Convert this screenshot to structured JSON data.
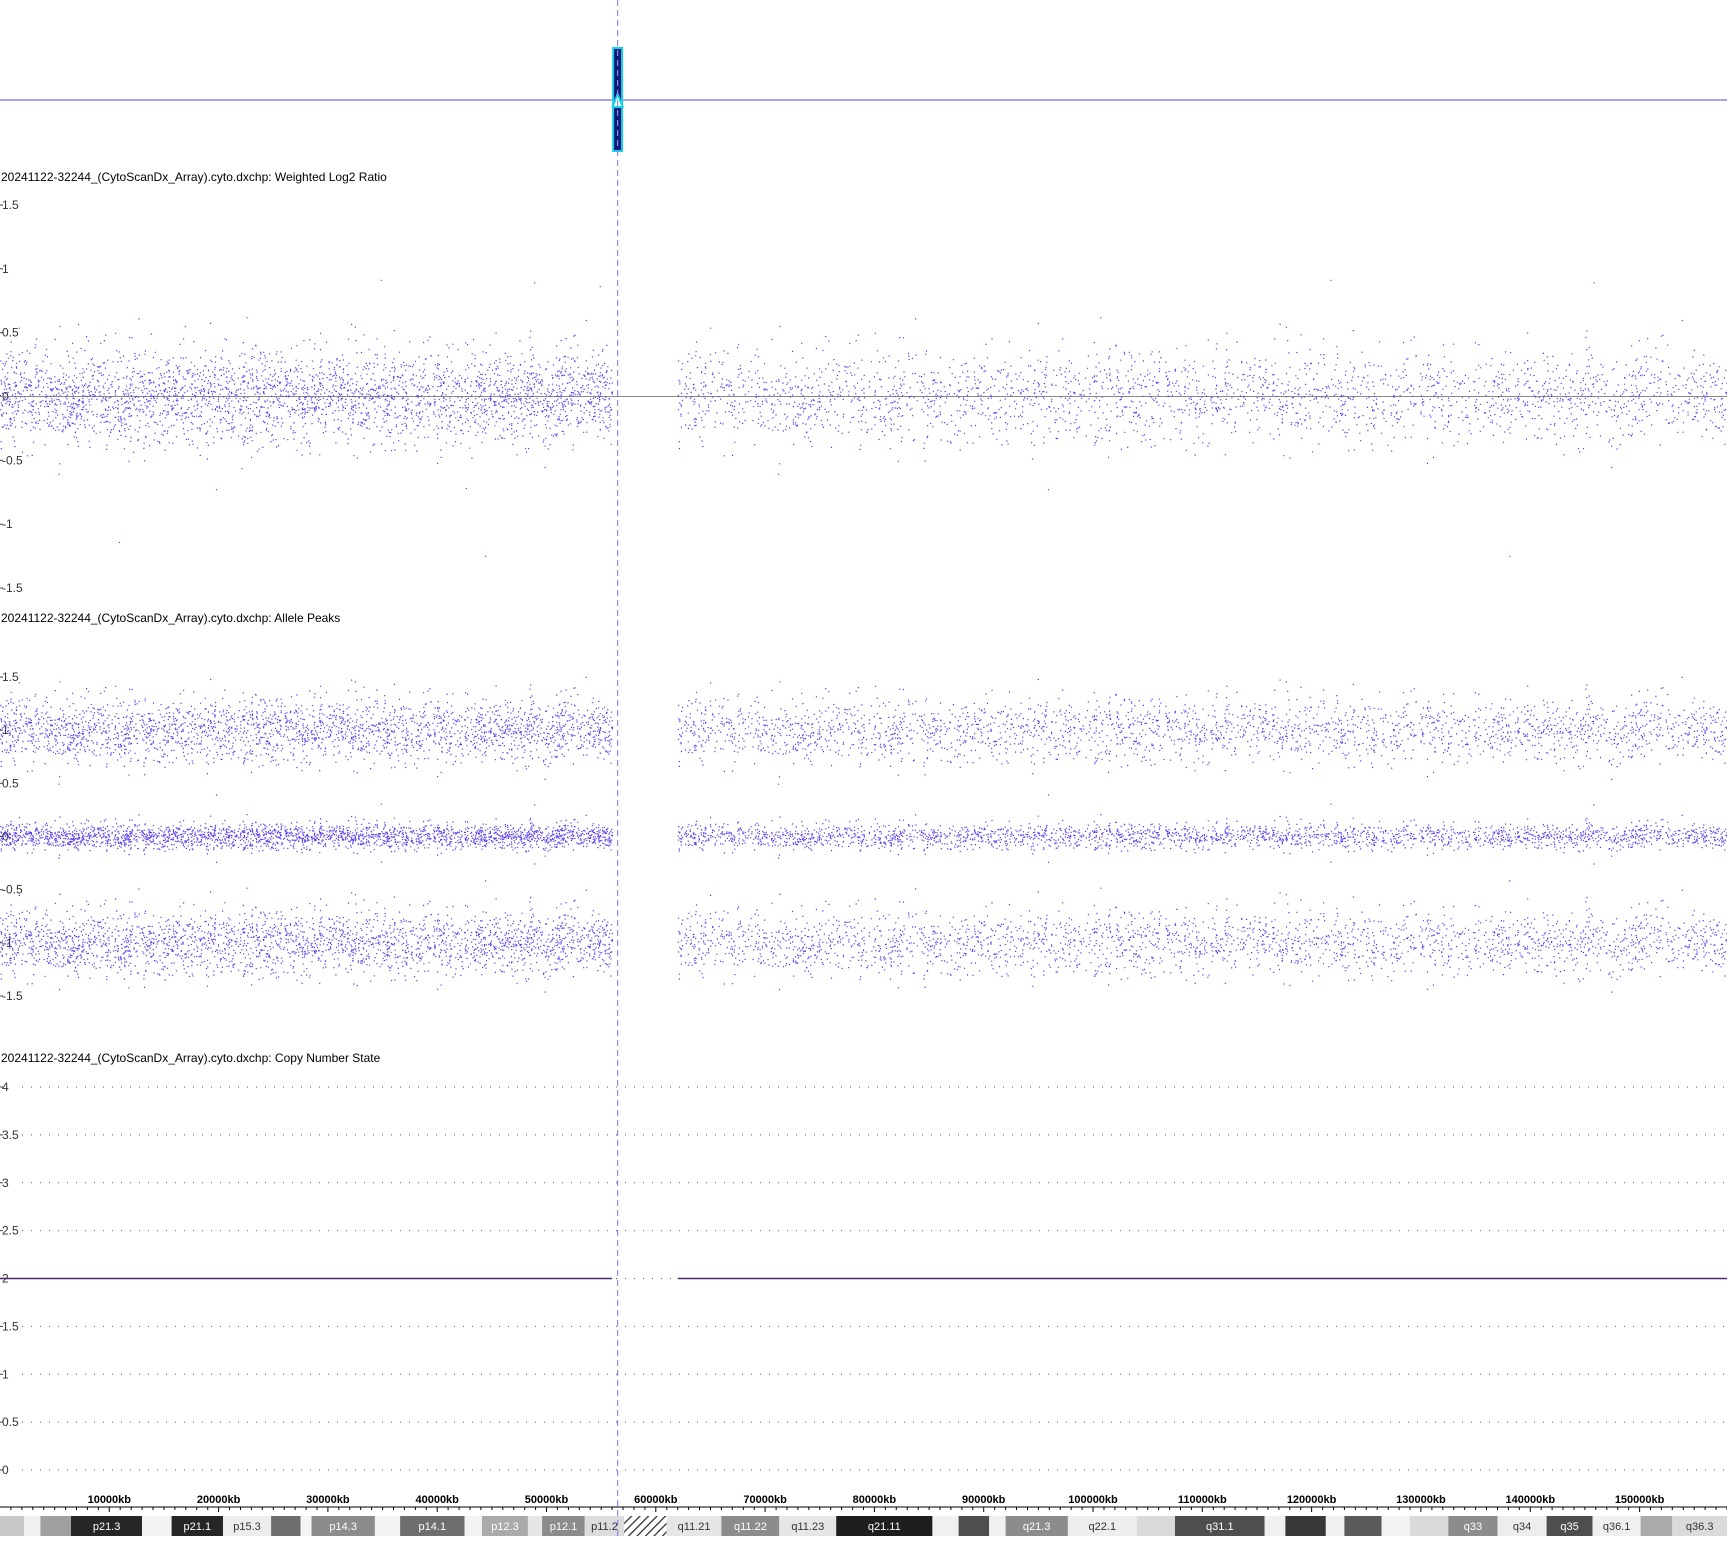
{
  "colors": {
    "data": "#5a3cf0",
    "cursor_line": "#8a8af0",
    "selection_line": "#4b4bd6",
    "marker_fill": "#0a1a7a",
    "marker_border": "#19d2e6",
    "cn_line": "#4b2a6a",
    "dotted_grid": "#555555",
    "band_text": "#ffffff"
  },
  "cursor": {
    "position_kb": 56500
  },
  "chart_data": [
    {
      "type": "scatter",
      "title": "20241122-32244_(CytoScanDx_Array).cyto.dxchp: Weighted Log2 Ratio",
      "ylim": [
        -1.5,
        1.5
      ],
      "y_ticks": [
        "1.5",
        "1",
        "0.5",
        "0",
        "-0.5",
        "-1",
        "-1.5"
      ],
      "baseline": 0,
      "grid": false,
      "segments_kb": [
        [
          0,
          56000
        ],
        [
          62000,
          158000
        ]
      ],
      "bands": [
        {
          "center": 0.0,
          "spread": 0.18
        }
      ]
    },
    {
      "type": "scatter",
      "title": "20241122-32244_(CytoScanDx_Array).cyto.dxchp: Allele Peaks",
      "ylim": [
        -1.5,
        1.5
      ],
      "y_ticks": [
        "1.5",
        "1",
        "0.5",
        "0",
        "-0.5",
        "-1",
        "-1.5"
      ],
      "grid": false,
      "segments_kb": [
        [
          0,
          56000
        ],
        [
          62000,
          158000
        ]
      ],
      "bands": [
        {
          "center": 1.0,
          "spread": 0.15
        },
        {
          "center": 0.0,
          "spread": 0.06
        },
        {
          "center": -1.0,
          "spread": 0.15
        }
      ]
    },
    {
      "type": "line",
      "title": "20241122-32244_(CytoScanDx_Array).cyto.dxchp: Copy Number State",
      "ylim": [
        0,
        4
      ],
      "y_ticks": [
        "4",
        "3.5",
        "3",
        "2.5",
        "2",
        "1.5",
        "1",
        "0.5",
        "0"
      ],
      "grid": true,
      "segments": [
        {
          "x": [
            0,
            56000
          ],
          "y": 2
        },
        {
          "x": [
            62000,
            158000
          ],
          "y": 2
        }
      ]
    }
  ],
  "x_axis": {
    "range_kb": [
      0,
      158000
    ],
    "ticks": [
      "10000kb",
      "20000kb",
      "30000kb",
      "40000kb",
      "50000kb",
      "60000kb",
      "70000kb",
      "80000kb",
      "90000kb",
      "100000kb",
      "110000kb",
      "120000kb",
      "130000kb",
      "140000kb",
      "150000kb"
    ],
    "tick_values_kb": [
      10000,
      20000,
      30000,
      40000,
      50000,
      60000,
      70000,
      80000,
      90000,
      100000,
      110000,
      120000,
      130000,
      140000,
      150000
    ]
  },
  "ideogram": [
    {
      "start": 0,
      "end": 2200,
      "label": "",
      "shade": "#c8c8c8"
    },
    {
      "start": 2200,
      "end": 3700,
      "label": "",
      "shade": "#f0f0f0"
    },
    {
      "start": 3700,
      "end": 6500,
      "label": "",
      "shade": "#a0a0a0"
    },
    {
      "start": 6500,
      "end": 13000,
      "label": "p21.3",
      "shade": "#262626"
    },
    {
      "start": 13000,
      "end": 15700,
      "label": "",
      "shade": "#f2f2f2"
    },
    {
      "start": 15700,
      "end": 20400,
      "label": "p21.1",
      "shade": "#262626"
    },
    {
      "start": 20400,
      "end": 24800,
      "label": "p15.3",
      "shade": "#ededed"
    },
    {
      "start": 24800,
      "end": 27500,
      "label": "",
      "shade": "#6e6e6e"
    },
    {
      "start": 27500,
      "end": 28500,
      "label": "",
      "shade": "#f5f5f5"
    },
    {
      "start": 28500,
      "end": 34300,
      "label": "p14.3",
      "shade": "#8c8c8c"
    },
    {
      "start": 34300,
      "end": 36600,
      "label": "",
      "shade": "#f2f2f2"
    },
    {
      "start": 36600,
      "end": 42500,
      "label": "p14.1",
      "shade": "#6e6e6e"
    },
    {
      "start": 42500,
      "end": 44100,
      "label": "",
      "shade": "#f2f2f2"
    },
    {
      "start": 44100,
      "end": 48300,
      "label": "p12.3",
      "shade": "#aaaaaa"
    },
    {
      "start": 48300,
      "end": 49600,
      "label": "",
      "shade": "#e6e6e6"
    },
    {
      "start": 49600,
      "end": 53500,
      "label": "p12.1",
      "shade": "#8c8c8c"
    },
    {
      "start": 53500,
      "end": 57100,
      "label": "p11.2",
      "shade": "#dcdcdc"
    },
    {
      "start": 57100,
      "end": 61000,
      "label": "",
      "shade": "hatch"
    },
    {
      "start": 61000,
      "end": 66000,
      "label": "q11.21",
      "shade": "#e6e6e6"
    },
    {
      "start": 66000,
      "end": 71300,
      "label": "q11.22",
      "shade": "#8c8c8c"
    },
    {
      "start": 71300,
      "end": 76500,
      "label": "q11.23",
      "shade": "#e6e6e6"
    },
    {
      "start": 76500,
      "end": 85300,
      "label": "q21.11",
      "shade": "#1e1e1e"
    },
    {
      "start": 85300,
      "end": 87700,
      "label": "",
      "shade": "#f0f0f0"
    },
    {
      "start": 87700,
      "end": 90500,
      "label": "",
      "shade": "#4e4e4e"
    },
    {
      "start": 90500,
      "end": 92000,
      "label": "",
      "shade": "#f0f0f0"
    },
    {
      "start": 92000,
      "end": 97700,
      "label": "q21.3",
      "shade": "#8c8c8c"
    },
    {
      "start": 97700,
      "end": 104000,
      "label": "q22.1",
      "shade": "#ededed"
    },
    {
      "start": 104000,
      "end": 107500,
      "label": "",
      "shade": "#dadada"
    },
    {
      "start": 107500,
      "end": 115700,
      "label": "q31.1",
      "shade": "#4e4e4e"
    },
    {
      "start": 115700,
      "end": 117600,
      "label": "",
      "shade": "#f0f0f0"
    },
    {
      "start": 117600,
      "end": 121300,
      "label": "",
      "shade": "#383838"
    },
    {
      "start": 121300,
      "end": 123000,
      "label": "",
      "shade": "#f0f0f0"
    },
    {
      "start": 123000,
      "end": 126400,
      "label": "",
      "shade": "#5a5a5a"
    },
    {
      "start": 126400,
      "end": 129000,
      "label": "",
      "shade": "#f2f2f2"
    },
    {
      "start": 129000,
      "end": 132500,
      "label": "",
      "shade": "#dadada"
    },
    {
      "start": 132500,
      "end": 137000,
      "label": "q33",
      "shade": "#8c8c8c"
    },
    {
      "start": 137000,
      "end": 141500,
      "label": "q34",
      "shade": "#ededed"
    },
    {
      "start": 141500,
      "end": 145700,
      "label": "q35",
      "shade": "#4e4e4e"
    },
    {
      "start": 145700,
      "end": 150100,
      "label": "q36.1",
      "shade": "#f0f0f0"
    },
    {
      "start": 150100,
      "end": 153000,
      "label": "",
      "shade": "#aaaaaa"
    },
    {
      "start": 153000,
      "end": 158000,
      "label": "q36.3",
      "shade": "#dadada"
    }
  ]
}
